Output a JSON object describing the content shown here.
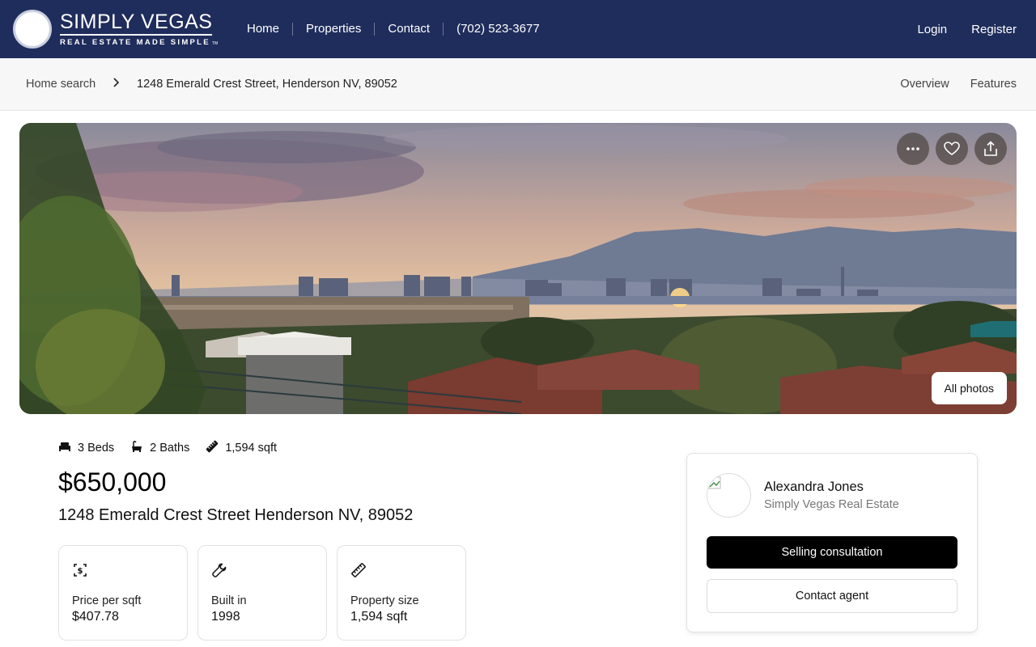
{
  "brand": {
    "name": "SIMPLY VEGAS",
    "tagline": "REAL ESTATE MADE SIMPLE",
    "trademark": "TM"
  },
  "nav": {
    "items": [
      "Home",
      "Properties",
      "Contact",
      "(702) 523-3677"
    ]
  },
  "auth": {
    "login": "Login",
    "register": "Register"
  },
  "breadcrumb": {
    "home": "Home search",
    "separator": "›",
    "current": "1248 Emerald Crest Street, Henderson NV, 89052",
    "tabs": [
      "Overview",
      "Features"
    ]
  },
  "hero": {
    "more_icon": "more-horizontal-icon",
    "favorite_icon": "heart-icon",
    "share_icon": "share-icon",
    "all_photos": "All photos"
  },
  "listing": {
    "beds": "3 Beds",
    "baths": "2 Baths",
    "sqft": "1,594 sqft",
    "price": "$650,000",
    "address": "1248 Emerald Crest Street Henderson NV, 89052"
  },
  "stats": [
    {
      "icon": "price-tag-icon",
      "label": "Price per sqft",
      "value": "$407.78"
    },
    {
      "icon": "wrench-icon",
      "label": "Built in",
      "value": "1998"
    },
    {
      "icon": "ruler-icon",
      "label": "Property size",
      "value": "1,594 sqft"
    }
  ],
  "agent": {
    "name": "Alexandra Jones",
    "company": "Simply Vegas Real Estate",
    "primary_button": "Selling consultation",
    "secondary_button": "Contact agent"
  },
  "colors": {
    "header_bg": "#1f2d5c",
    "primary_button": "#000000"
  }
}
